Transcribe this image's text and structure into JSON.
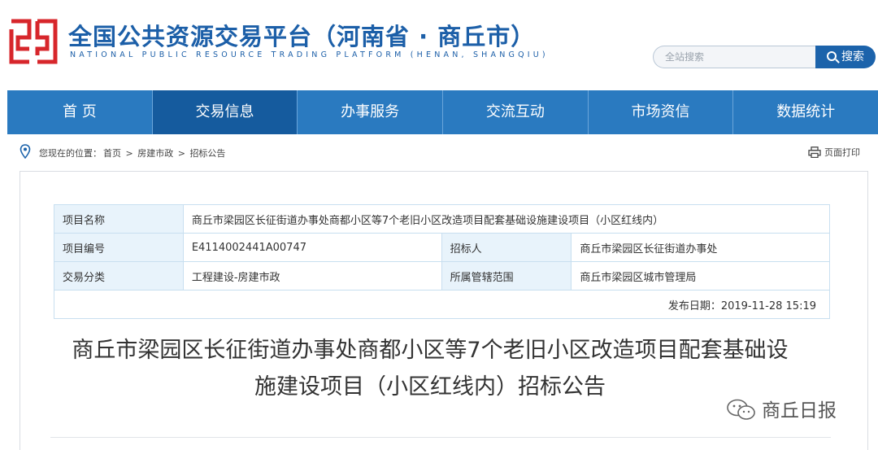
{
  "header": {
    "title": "全国公共资源交易平台（河南省 · 商丘市）",
    "subtitle": "NATIONAL PUBLIC RESOURCE TRADING PLATFORM (HENAN, SHANGQIU)",
    "search_placeholder": "全站搜索",
    "search_button": "搜索",
    "brand_color": "#1c5fa8",
    "logo_color": "#d7262b"
  },
  "nav": {
    "items": [
      "首 页",
      "交易信息",
      "办事服务",
      "交流互动",
      "市场资信",
      "数据统计"
    ],
    "active_index": 1,
    "bg_color": "#2a7ac0",
    "active_color": "#155b9e"
  },
  "breadcrumb": {
    "prefix": "您现在的位置：",
    "items": [
      "首页",
      ">",
      "房建市政",
      ">",
      "招标公告"
    ],
    "print_label": "页面打印"
  },
  "project": {
    "name_label": "项目名称",
    "name_value": "商丘市梁园区长征街道办事处商都小区等7个老旧小区改造项目配套基础设施建设项目（小区红线内）",
    "code_label": "项目编号",
    "code_value": "E4114002441A00747",
    "tenderer_label": "招标人",
    "tenderer_value": "商丘市梁园区长征街道办事处",
    "category_label": "交易分类",
    "category_value": "工程建设-房建市政",
    "jurisdiction_label": "所属管辖范围",
    "jurisdiction_value": "商丘市梁园区城市管理局",
    "publish_date": "发布日期：2019-11-28 15:19"
  },
  "document": {
    "title_line1": "商丘市梁园区长征街道办事处商都小区等7个老旧小区改造项目配套基础设",
    "title_line2": "施建设项目（小区红线内）招标公告"
  },
  "watermark": {
    "text": "商丘日报"
  }
}
